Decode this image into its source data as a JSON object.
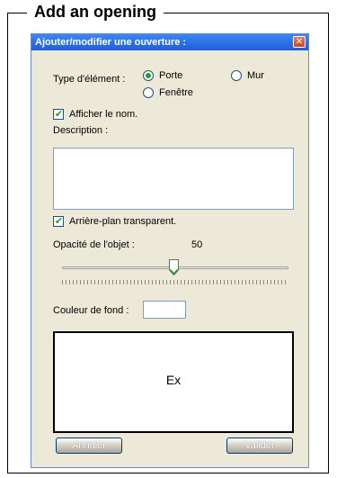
{
  "figure_title": "Add an opening",
  "dialog": {
    "title": "Ajouter/modifier une ouverture :",
    "close_glyph": "✕",
    "type_label": "Type d'élément :",
    "type_options": [
      {
        "label": "Porte",
        "checked": true
      },
      {
        "label": "Mur",
        "checked": false
      },
      {
        "label": "Fenêtre",
        "checked": false
      }
    ],
    "show_name": {
      "label": "Afficher le nom.",
      "checked": true
    },
    "description_label": "Description :",
    "description_value": "",
    "transparent_bg": {
      "label": "Arrière-plan transparent.",
      "checked": true
    },
    "opacity_label": "Opacité de l'objet :",
    "opacity_value": "50",
    "background_color_label": "Couleur de fond :",
    "background_color": "#ffffff",
    "preview_text": "Ex",
    "cancel_label": "Annuler",
    "validate_label": "Valider"
  },
  "colors": {
    "titlebar": "#1d5fd7",
    "dialog_bg": "#ece9d8",
    "check_green": "#21a121"
  }
}
